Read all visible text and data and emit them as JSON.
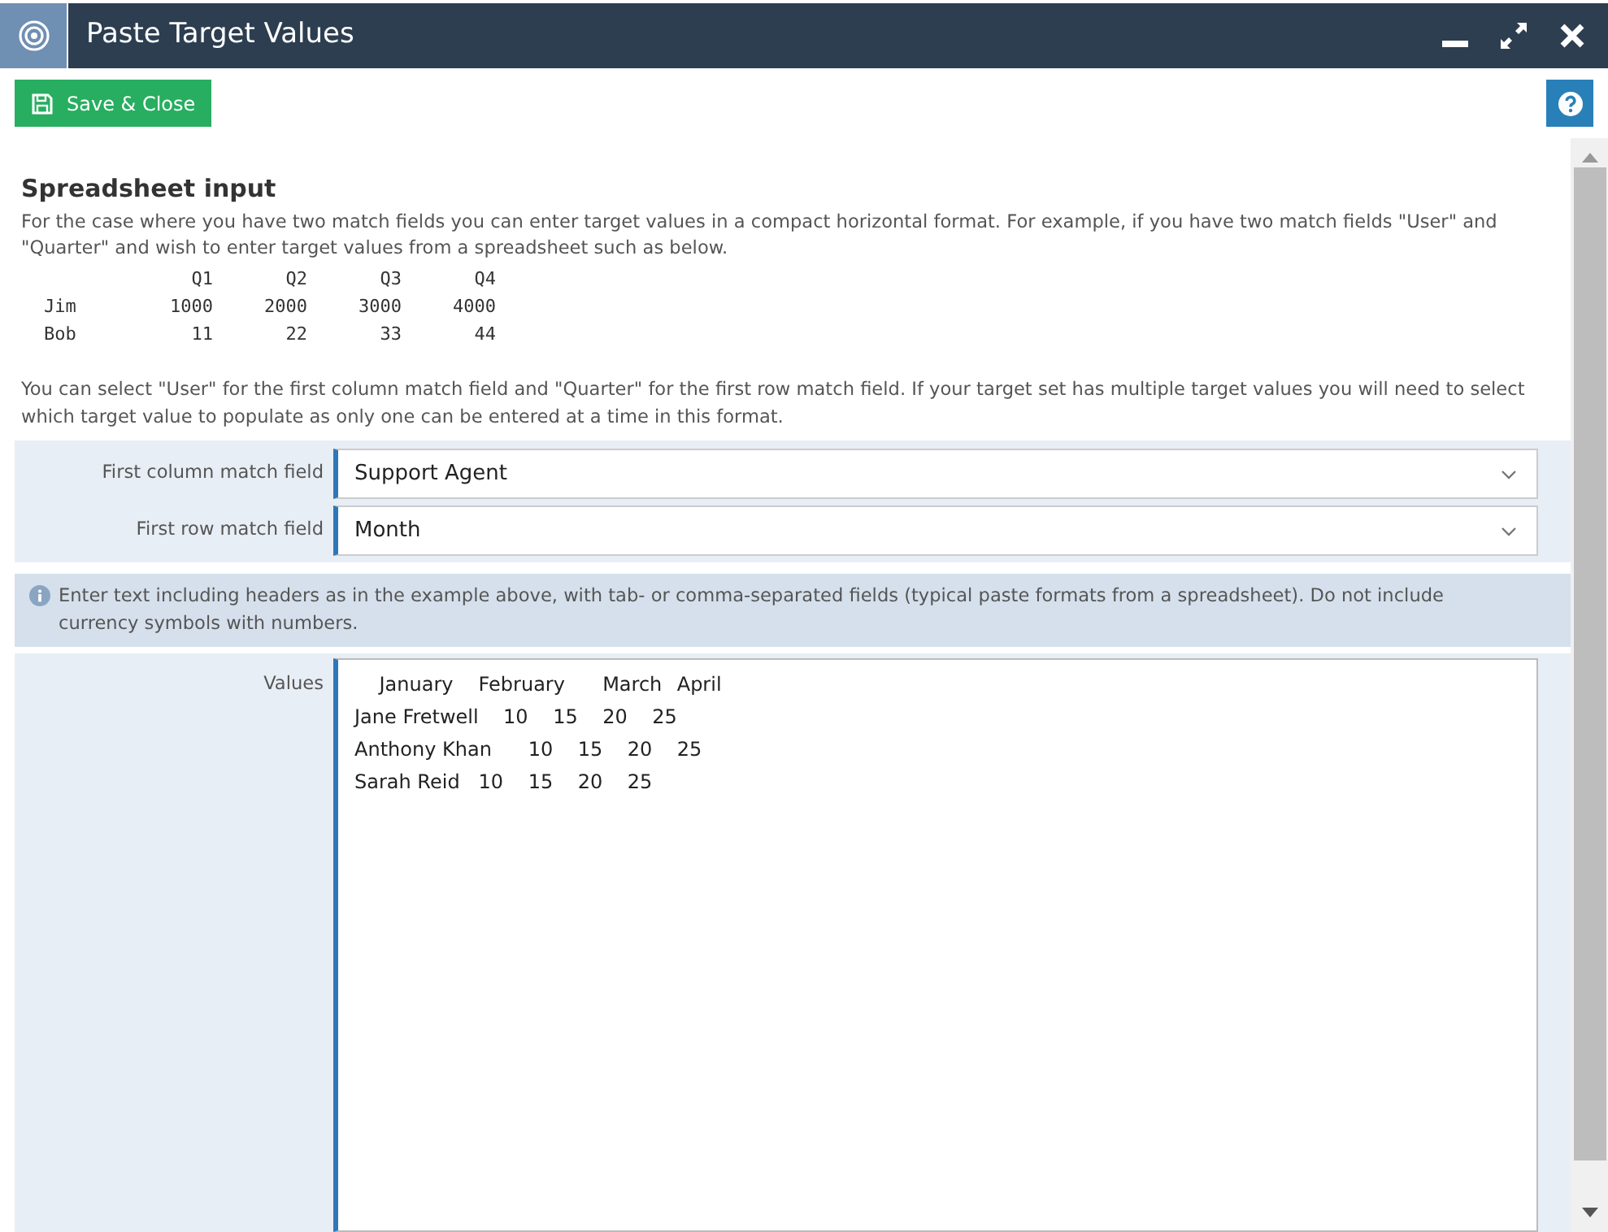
{
  "window": {
    "title": "Paste Target Values"
  },
  "toolbar": {
    "save_button": "Save & Close"
  },
  "section": {
    "heading": "Spreadsheet input",
    "intro": "For the case where you have two match fields you can enter target values in a compact horizontal format. For example, if you have two match fields \"User\" and \"Quarter\" and wish to enter target values from a spreadsheet such as below.",
    "example": {
      "columns": [
        "Q1",
        "Q2",
        "Q3",
        "Q4"
      ],
      "rows": [
        {
          "label": "Jim",
          "values": [
            "1000",
            "2000",
            "3000",
            "4000"
          ]
        },
        {
          "label": "Bob",
          "values": [
            "11",
            "22",
            "33",
            "44"
          ]
        }
      ]
    },
    "note": "You can select \"User\" for the first column match field and \"Quarter\" for the first row match field. If your target set has multiple target values you will need to select which target value to populate as only one can be entered at a time in this format."
  },
  "fields": [
    {
      "label": "First column match field",
      "value": "Support Agent"
    },
    {
      "label": "First row match field",
      "value": "Month"
    }
  ],
  "info": "Enter text including headers as in the example above, with tab- or comma-separated fields (typical paste formats from a spreadsheet). Do not include currency symbols with numbers.",
  "values": {
    "label": "Values",
    "text": "\tJanuary\tFebruary\t\tMarch\tApril\nJane Fretwell\t10\t15\t20\t25\nAnthony Khan\t\t10\t15\t20\t25\nSarah Reid\t10\t15\t20\t25\n"
  }
}
